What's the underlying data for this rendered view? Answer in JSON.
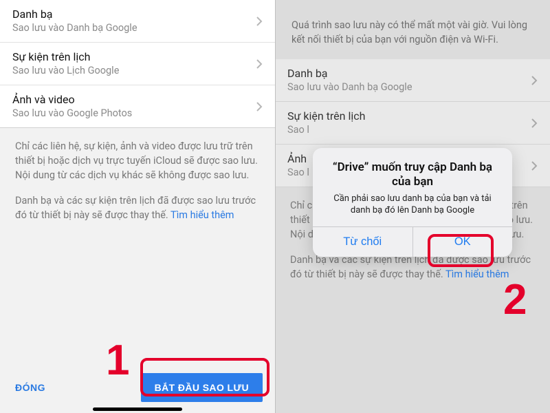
{
  "left": {
    "rows": [
      {
        "title": "Danh bạ",
        "sub": "Sao lưu vào Danh bạ Google"
      },
      {
        "title": "Sự kiện trên lịch",
        "sub": "Sao lưu vào Lịch Google"
      },
      {
        "title": "Ảnh và video",
        "sub": "Sao lưu vào Google Photos"
      }
    ],
    "info1": "Chỉ các liên hệ, sự kiện, ảnh và video được lưu trữ trên thiết bị hoặc dịch vụ trực tuyến iCloud sẽ được sao lưu. Nội dung từ các dịch vụ khác sẽ không được sao lưu.",
    "info2_a": "Danh bạ và các sự kiện trên lịch đã được sao lưu trước đó từ thiết bị này sẽ được thay thế. ",
    "info2_link": "Tìm hiểu thêm",
    "close": "ĐÓNG",
    "start": "BẮT ĐẦU SAO LƯU"
  },
  "right": {
    "top": "Quá trình sao lưu này có thể mất một vài giờ. Vui lòng kết nối thiết bị của bạn với nguồn điện và Wi-Fi.",
    "rows": [
      {
        "title": "Danh bạ",
        "sub": "Sao lưu vào Danh bạ Google"
      },
      {
        "title": "Sự kiện trên lịch",
        "sub": "Sao l"
      },
      {
        "title": "Ảnh",
        "sub": "Sao l"
      }
    ],
    "info1": "Chỉ các liên hệ, sự kiện, ảnh và video được lưu trữ trên thiết bị hoặc dịch vụ trực tuyến iCloud sẽ được sao lưu. Nội dung từ các dịch vụ khác sẽ không được sao lưu.",
    "info2_a": "Danh bạ và các sự kiện trên lịch đã được sao lưu trước đó từ thiết bị này sẽ được thay thế. ",
    "info2_link": "Tìm hiểu thêm"
  },
  "alert": {
    "title": "“Drive” muốn truy cập Danh bạ của bạn",
    "message": "Cần phải sao lưu danh bạ của bạn và tải danh bạ đó lên Danh bạ Google",
    "deny": "Từ chối",
    "ok": "OK"
  },
  "steps": {
    "one": "1",
    "two": "2"
  }
}
